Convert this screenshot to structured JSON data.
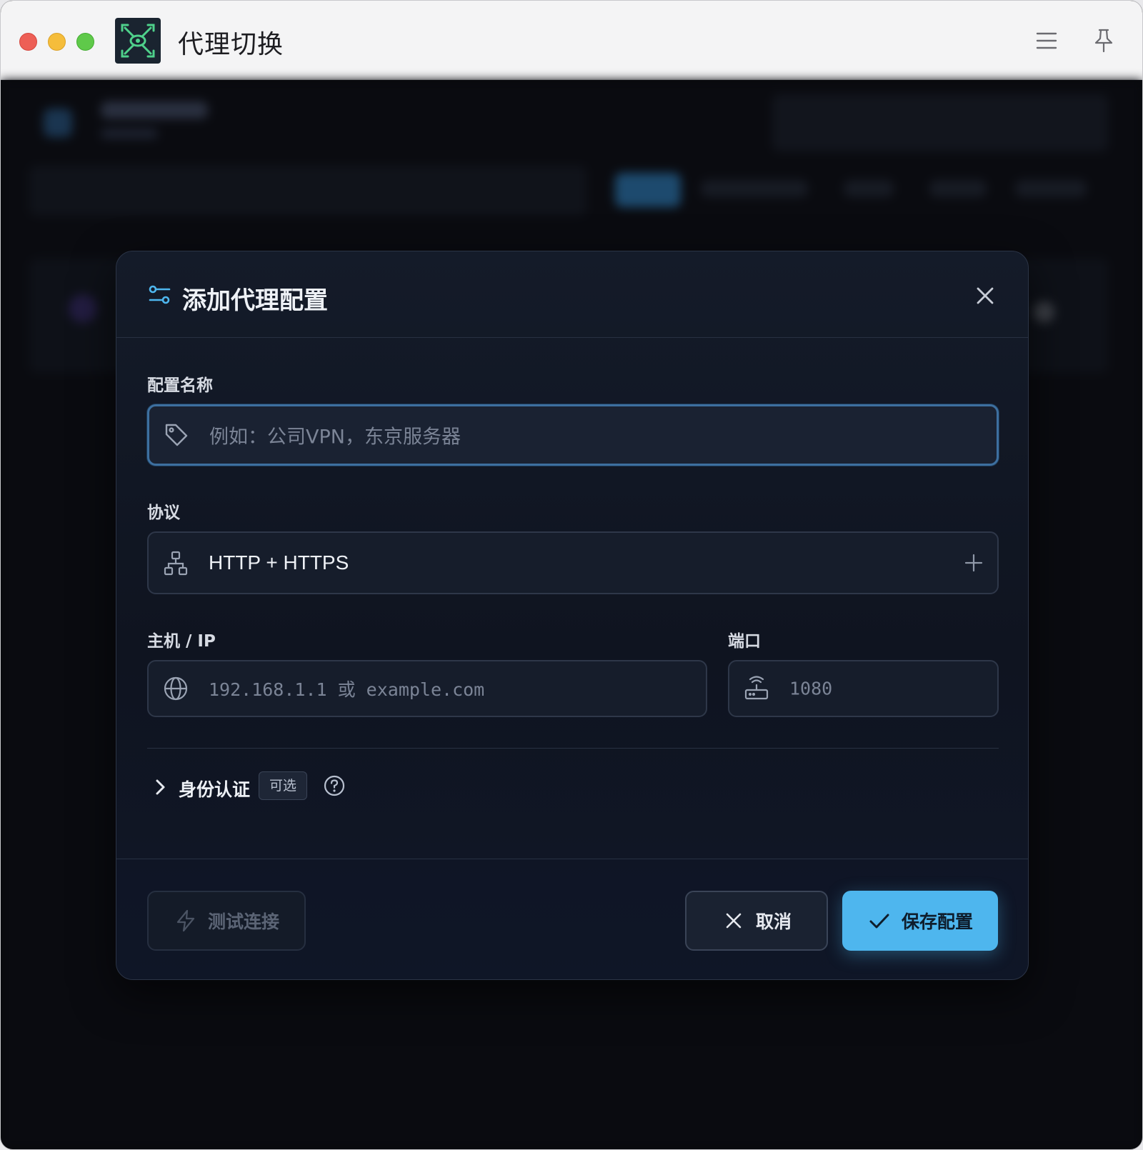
{
  "window": {
    "title": "代理切换"
  },
  "modal": {
    "title": "添加代理配置",
    "name_field": {
      "label": "配置名称",
      "placeholder": "例如：公司VPN，东京服务器"
    },
    "protocol_field": {
      "label": "协议",
      "value": "HTTP + HTTPS"
    },
    "host_field": {
      "label": "主机 / IP",
      "placeholder": "192.168.1.1 或 example.com"
    },
    "port_field": {
      "label": "端口",
      "placeholder": "1080"
    },
    "auth": {
      "label": "身份认证",
      "badge": "可选"
    },
    "buttons": {
      "test": "测试连接",
      "cancel": "取消",
      "save": "保存配置"
    }
  },
  "colors": {
    "accent": "#4eb6ee",
    "modal_bg": "#121928",
    "field_border_focus": "#3d6f9f"
  }
}
